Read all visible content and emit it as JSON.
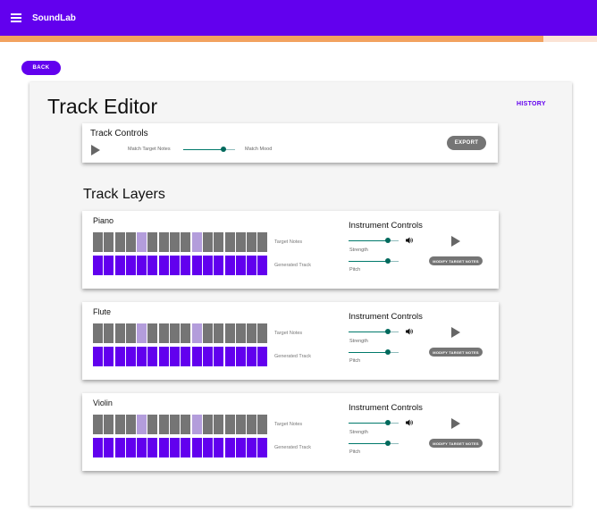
{
  "app": {
    "title": "SoundLab",
    "progress_percent": 91
  },
  "nav": {
    "back_label": "BACK"
  },
  "page": {
    "title": "Track Editor",
    "history_label": "HISTORY"
  },
  "track_controls": {
    "title": "Track Controls",
    "left_label": "Match Target Notes",
    "right_label": "Match Mood",
    "slider_fraction": 0.77,
    "export_label": "EXPORT"
  },
  "layers_title": "Track Layers",
  "layers": [
    {
      "name": "Piano",
      "target_label": "Target Notes",
      "generated_label": "Generated Track",
      "controls_title": "Instrument Controls",
      "strength_label": "Strength",
      "pitch_label": "Pitch",
      "strength_fraction": 0.78,
      "pitch_fraction": 0.78,
      "modify_label": "MODIFY TARGET NOTES"
    },
    {
      "name": "Flute",
      "target_label": "Target Notes",
      "generated_label": "Generated Track",
      "controls_title": "Instrument Controls",
      "strength_label": "Strength",
      "pitch_label": "Pitch",
      "strength_fraction": 0.78,
      "pitch_fraction": 0.78,
      "modify_label": "MODIFY TARGET NOTES"
    },
    {
      "name": "Violin",
      "target_label": "Target Notes",
      "generated_label": "Generated Track",
      "controls_title": "Instrument Controls",
      "strength_label": "Strength",
      "pitch_label": "Pitch",
      "strength_fraction": 0.78,
      "pitch_fraction": 0.78,
      "modify_label": "MODIFY TARGET NOTES"
    }
  ],
  "target_pattern": [
    "gray",
    "gray",
    "gray",
    "gray",
    "lilac",
    "gray",
    "gray",
    "gray",
    "gray",
    "lilac",
    "gray",
    "gray",
    "gray",
    "gray",
    "gray",
    "gray"
  ],
  "colors": {
    "primary": "#6200ee",
    "progress": "#f2a25f",
    "note_gray": "#757575",
    "note_highlight": "#b39ddb",
    "slider": "#00695c"
  },
  "icons": {
    "menu": "menu-icon",
    "play": "play-icon",
    "volume": "volume-icon"
  }
}
